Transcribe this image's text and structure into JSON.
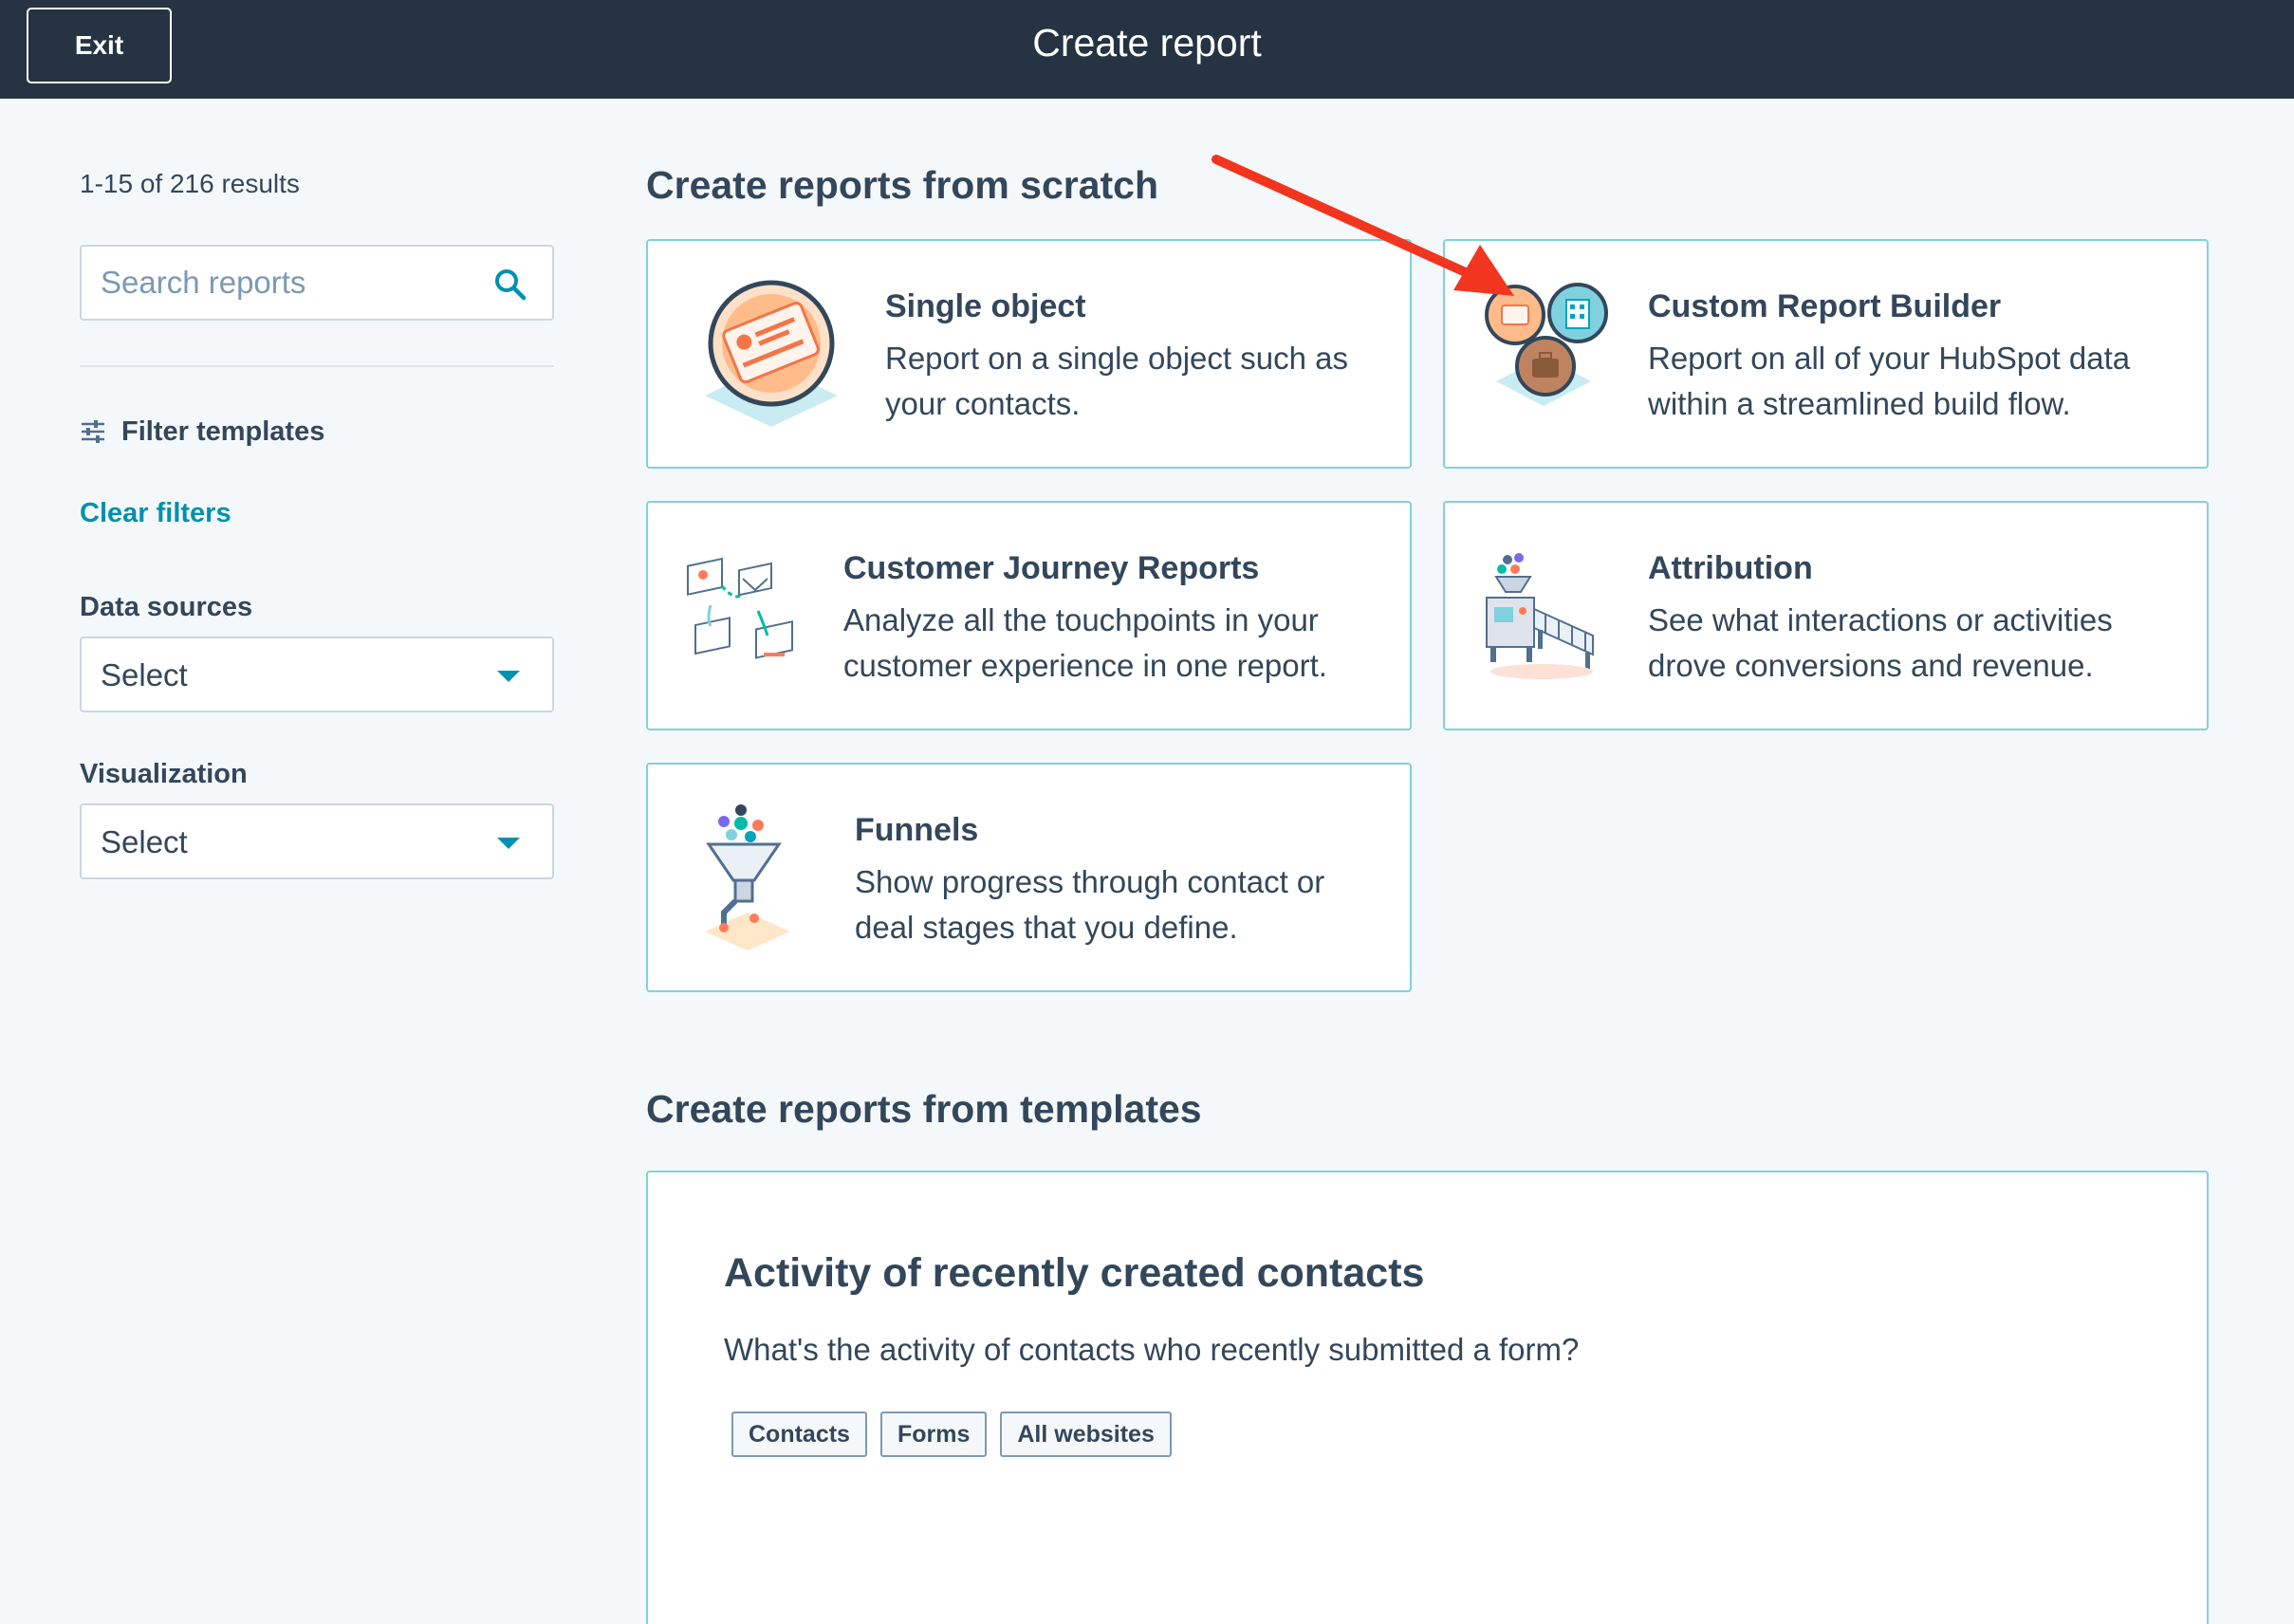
{
  "header": {
    "exit_label": "Exit",
    "title": "Create report"
  },
  "sidebar": {
    "results_count": "1-15 of 216 results",
    "search": {
      "placeholder": "Search reports",
      "value": ""
    },
    "filter_heading": "Filter templates",
    "clear_filters": "Clear filters",
    "data_sources": {
      "label": "Data sources",
      "selected": "Select"
    },
    "visualization": {
      "label": "Visualization",
      "selected": "Select"
    }
  },
  "scratch": {
    "heading": "Create reports from scratch",
    "cards": [
      {
        "title": "Single object",
        "description": "Report on a single object such as your contacts.",
        "icon": "single-object-icon"
      },
      {
        "title": "Custom Report Builder",
        "description": "Report on all of your HubSpot data within a streamlined build flow.",
        "icon": "custom-report-builder-icon"
      },
      {
        "title": "Customer Journey Reports",
        "description": "Analyze all the touchpoints in your customer experience in one report.",
        "icon": "customer-journey-icon"
      },
      {
        "title": "Attribution",
        "description": "See what interactions or activities drove conversions and revenue.",
        "icon": "attribution-icon"
      },
      {
        "title": "Funnels",
        "description": "Show progress through contact or deal stages that you define.",
        "icon": "funnel-icon"
      }
    ]
  },
  "templates": {
    "heading": "Create reports from templates",
    "items": [
      {
        "title": "Activity of recently created contacts",
        "description": "What's the activity of contacts who recently submitted a form?",
        "tags": [
          "Contacts",
          "Forms",
          "All websites"
        ]
      }
    ]
  },
  "colors": {
    "topbar": "#253342",
    "accent": "#0091ae",
    "card_border": "#7fd1de",
    "arrow": "#f2351f"
  }
}
